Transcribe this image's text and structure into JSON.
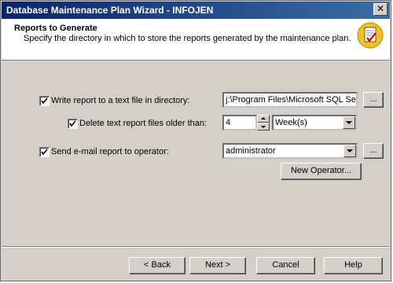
{
  "window": {
    "title": "Database Maintenance Plan Wizard - INFOJEN",
    "close_glyph": "✕"
  },
  "header": {
    "title": "Reports to Generate",
    "subtitle": "Specify the directory in which to store the reports generated by the maintenance plan.",
    "icon": "wizard-report-icon"
  },
  "options": {
    "write_report": {
      "label": "Write report to a text file in directory:",
      "checked": true,
      "path_value": "j:\\Program Files\\Microsoft SQL Serve",
      "browse_label": "..."
    },
    "delete_old": {
      "label": "Delete text report files older than:",
      "checked": true,
      "count_value": "4",
      "unit_value": "Week(s)"
    },
    "send_email": {
      "label": "Send e-mail report to operator:",
      "checked": true,
      "operator_value": "administrator",
      "browse_label": "...",
      "new_operator_label": "New Operator..."
    }
  },
  "footer": {
    "back_label": "< Back",
    "next_label": "Next >",
    "cancel_label": "Cancel",
    "help_label": "Help"
  }
}
